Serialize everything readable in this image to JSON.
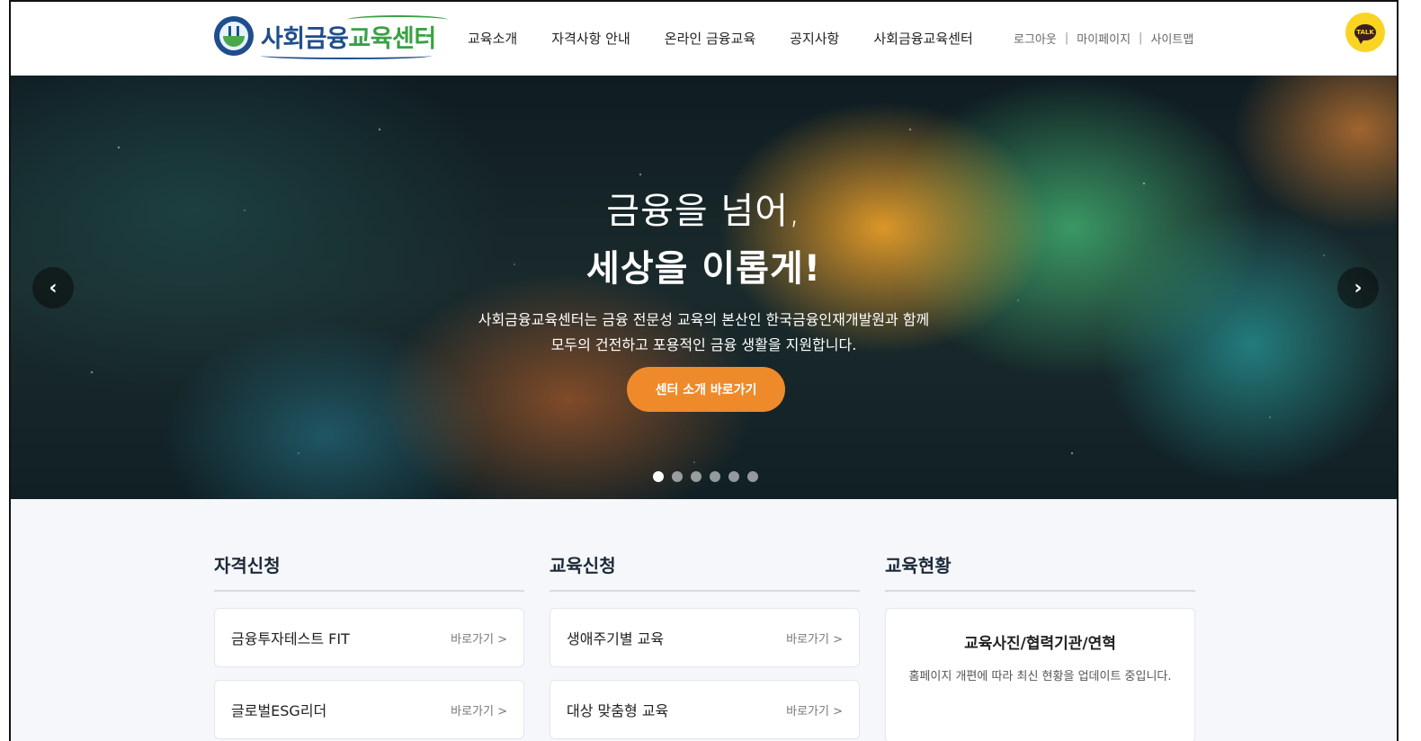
{
  "header": {
    "logo": {
      "part1": "사회금융",
      "part2": "교육센터"
    },
    "nav": [
      "교육소개",
      "자격사항 안내",
      "온라인 금융교육",
      "공지사항",
      "사회금융교육센터"
    ],
    "util": [
      "로그아웃",
      "마이페이지",
      "사이트맵"
    ],
    "util_separator": "|",
    "talk_label": "TALK"
  },
  "hero": {
    "line1": "금융을 넘어,",
    "line2": "세상을 이롭게!",
    "desc_line1": "사회금융교육센터는 금융 전문성 교육의 본산인 한국금융인재개발원과 함께",
    "desc_line2": "모두의 건전하고 포용적인 금융 생활을 지원합니다.",
    "button": "센터 소개 바로가기",
    "prev_icon": "‹",
    "next_icon": "›",
    "slide_count": 6,
    "active_slide": 1
  },
  "sections": {
    "cert": {
      "heading": "자격신청",
      "items": [
        {
          "title": "금융투자테스트 FIT",
          "link": "바로가기 >"
        },
        {
          "title": "글로벌ESG리더",
          "link": "바로가기 >"
        }
      ]
    },
    "edu": {
      "heading": "교육신청",
      "items": [
        {
          "title": "생애주기별 교육",
          "link": "바로가기 >"
        },
        {
          "title": "대상 맞춤형 교육",
          "link": "바로가기 >"
        }
      ]
    },
    "status": {
      "heading": "교육현황",
      "card_title": "교육사진/협력기관/연혁",
      "card_desc": "홈페이지 개편에 따라 최신 현황을 업데이트 중입니다."
    }
  },
  "colors": {
    "brand_blue": "#1f4e8c",
    "brand_green": "#3aa144",
    "accent_orange": "#ee8a2a",
    "kakao_yellow": "#f9d423"
  }
}
